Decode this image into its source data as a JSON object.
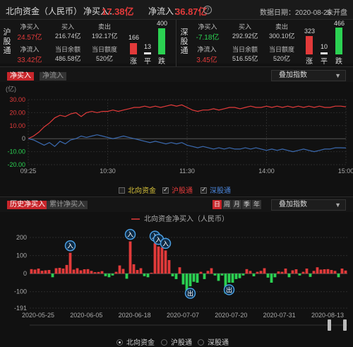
{
  "header": {
    "title": "北向资金（人民币）",
    "net_buy_label": "净买入：",
    "net_buy_value": "17.38亿",
    "net_inflow_label": "净流入：",
    "net_inflow_value": "36.87亿",
    "info_icon": "?",
    "date_label": "数据日期：2020-08-25",
    "status": "未开盘"
  },
  "hgt": {
    "name": "沪股通",
    "net_buy_label": "净买入",
    "net_buy_value": "24.57亿",
    "buy_label": "买入",
    "buy_value": "216.74亿",
    "sell_label": "卖出",
    "sell_value": "192.17亿",
    "net_inflow_label": "净流入",
    "net_inflow_value": "33.42亿",
    "balance_label": "当日余额",
    "balance_value": "486.58亿",
    "quota_label": "当日额度",
    "quota_value": "520亿",
    "up_count": "166",
    "flat_count": "13",
    "down_count": "400",
    "up_label": "涨",
    "flat_label": "平",
    "down_label": "跌"
  },
  "sgt": {
    "name": "深股通",
    "net_buy_label": "净买入",
    "net_buy_value": "-7.18亿",
    "buy_label": "买入",
    "buy_value": "292.92亿",
    "sell_label": "卖出",
    "sell_value": "300.10亿",
    "net_inflow_label": "净流入",
    "net_inflow_value": "3.45亿",
    "balance_label": "当日余额",
    "balance_value": "516.55亿",
    "quota_label": "当日额度",
    "quota_value": "520亿",
    "up_count": "323",
    "flat_count": "10",
    "down_count": "466",
    "up_label": "涨",
    "flat_label": "平",
    "down_label": "跌"
  },
  "intraday_tabs": {
    "net_buy": "净买入",
    "net_inflow": "净流入"
  },
  "overlay_select": "叠加指数",
  "intraday_legend": {
    "north": "北向资金",
    "hgt": "沪股通",
    "sgt": "深股通"
  },
  "history_tabs": {
    "history": "历史净买入",
    "cumulative": "累计净买入"
  },
  "period_buttons": [
    "日",
    "周",
    "月",
    "季",
    "年"
  ],
  "history_radios": [
    "北向资金",
    "沪股通",
    "深股通"
  ],
  "colors": {
    "red": "#e23a3a",
    "green": "#2bd152",
    "blue": "#3b6ab0",
    "bg": "#111111"
  },
  "chart_data": [
    {
      "type": "line",
      "ylabel": "(亿)",
      "ylim": [
        -20,
        30
      ],
      "y_ticks": [
        "30.00",
        "20.00",
        "10.00",
        "0",
        "-10.00",
        "-20.00"
      ],
      "x_ticks": [
        "09:25",
        "10:30",
        "11:30",
        "14:00",
        "15:00"
      ],
      "series": [
        {
          "name": "沪股通",
          "color": "#e23a3a",
          "values": [
            0,
            2,
            5,
            9,
            12,
            16,
            18,
            17,
            19,
            20,
            17,
            20,
            21,
            20,
            21,
            21,
            22,
            21,
            22,
            23,
            24,
            24,
            25,
            24,
            25,
            24,
            25,
            26,
            25,
            26,
            24,
            22,
            21,
            22,
            22,
            23,
            22,
            23,
            24,
            24,
            23,
            24,
            25,
            24,
            24,
            25,
            24,
            25,
            24,
            25,
            24,
            25,
            24,
            25,
            24,
            25,
            24,
            24,
            25,
            25,
            24.5
          ]
        },
        {
          "name": "深股通",
          "color": "#3b6ab0",
          "values": [
            0,
            -1,
            -3,
            -5,
            -3,
            -6,
            -2,
            -4,
            -1,
            0,
            2,
            1,
            2,
            3,
            2,
            1,
            0,
            1,
            2,
            1,
            0,
            -1,
            -2,
            -3,
            -2,
            -3,
            -4,
            -3,
            -4,
            -3,
            -5,
            -6,
            -7,
            -6,
            -7,
            -8,
            -7,
            -8,
            -7,
            -8,
            -8,
            -7,
            -8,
            -7,
            -8,
            -9,
            -8,
            -9,
            -8,
            -9,
            -10,
            -9,
            -8,
            -9,
            -10,
            -9,
            -8,
            -8,
            -7,
            -7,
            -7.2
          ]
        }
      ]
    },
    {
      "type": "bar",
      "title": "北向资金净买入（人民币）",
      "ylim": [
        -191,
        200
      ],
      "y_ticks": [
        "200",
        "100",
        "0",
        "-100",
        "-191"
      ],
      "x_ticks": [
        "2020-05-25",
        "2020-06-05",
        "2020-06-18",
        "2020-07-07",
        "2020-07-20",
        "2020-07-31",
        "2020-08-13"
      ],
      "values": [
        25,
        22,
        28,
        16,
        18,
        20,
        -20,
        30,
        32,
        28,
        48,
        115,
        22,
        30,
        18,
        24,
        25,
        15,
        8,
        9,
        14,
        -14,
        -20,
        -10,
        10,
        45,
        26,
        -28,
        178,
        52,
        20,
        30,
        -14,
        -20,
        5,
        168,
        150,
        145,
        128,
        75,
        -15,
        -30,
        35,
        -60,
        -115,
        -70,
        -45,
        -50,
        10,
        -30,
        15,
        30,
        -10,
        -40,
        -10,
        -110,
        -50,
        -50,
        -30,
        -25,
        -10,
        25,
        15,
        -15,
        10,
        15,
        30,
        -22,
        -50,
        -20,
        12,
        10,
        28,
        -20,
        18,
        24,
        -10,
        10,
        28,
        -18,
        15,
        35,
        22,
        24,
        25,
        20,
        15,
        -20,
        28,
        17
      ],
      "markers": [
        {
          "label": "入",
          "index": 11,
          "type": "in"
        },
        {
          "label": "入",
          "index": 28,
          "type": "in"
        },
        {
          "label": "入",
          "index": 35,
          "type": "in"
        },
        {
          "label": "入",
          "index": 36,
          "type": "in"
        },
        {
          "label": "入",
          "index": 38,
          "type": "in"
        },
        {
          "label": "出",
          "index": 45,
          "type": "out"
        },
        {
          "label": "出",
          "index": 56,
          "type": "out"
        }
      ]
    }
  ]
}
